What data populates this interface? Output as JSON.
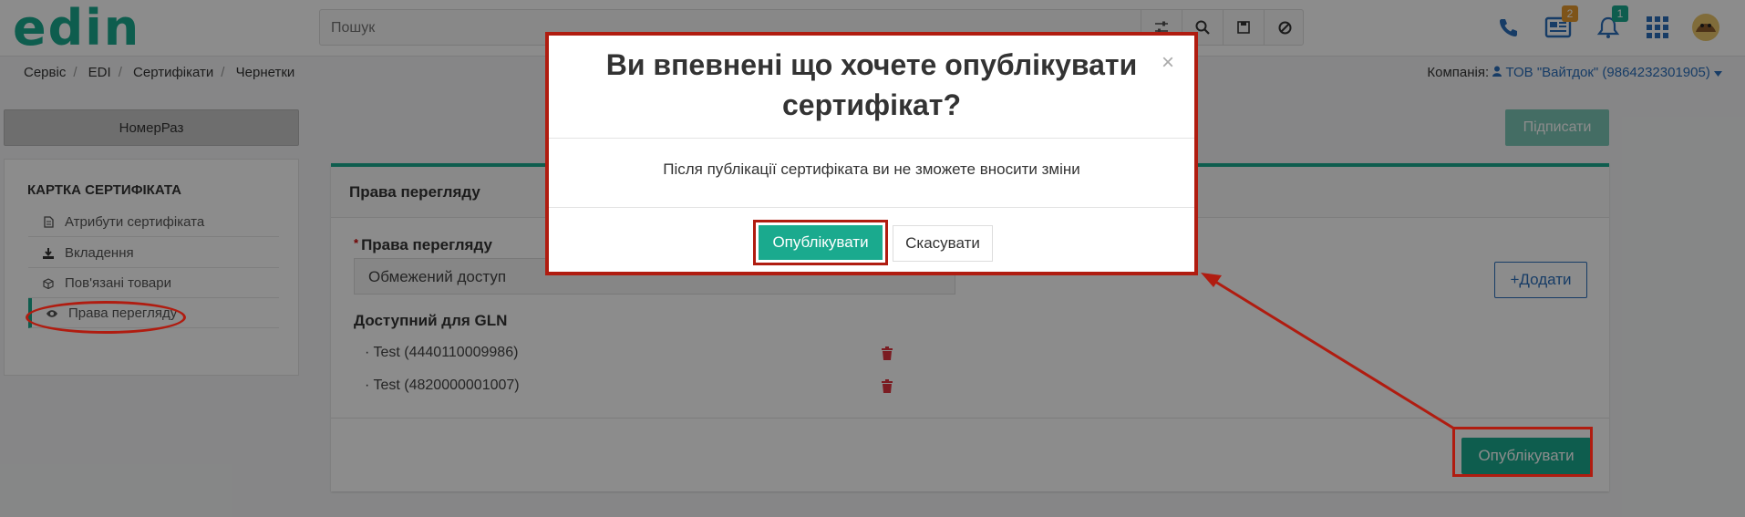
{
  "header": {
    "logo": "edin",
    "search_placeholder": "Пошук",
    "badges": {
      "news": "2",
      "notifications": "1"
    }
  },
  "breadcrumb": {
    "items": [
      "Сервіс",
      "EDI",
      "Сертифікати",
      "Чернетки"
    ]
  },
  "company": {
    "label": "Компанія:",
    "value": "ТОВ \"Вайтдок\" (9864232301905)"
  },
  "left": {
    "tab_label": "НомерРаз",
    "card_title": "КАРТКА СЕРТИФІКАТА",
    "items": [
      {
        "label": "Атрибути сертифіката",
        "icon": "document-icon"
      },
      {
        "label": "Вкладення",
        "icon": "download-icon"
      },
      {
        "label": "Пов'язані товари",
        "icon": "box-icon"
      },
      {
        "label": "Права перегляду",
        "icon": "eye-icon"
      }
    ]
  },
  "main": {
    "sign_button": "Підписати",
    "panel_title": "Права перегляду",
    "access_label": "Права перегляду",
    "access_value": "Обмежений доступ",
    "add_button": "+Додати",
    "gln_label": "Доступний для GLN",
    "gln_items": [
      "· Test (4440110009986)",
      "· Test (4820000001007)"
    ],
    "publish_button": "Опублікувати"
  },
  "modal": {
    "title_line1": "Ви впевнені що хочете опублікувати",
    "title_line2": "сертифікат?",
    "close": "×",
    "body": "Після публікації сертифіката ви не зможете вносити зміни",
    "confirm": "Опублікувати",
    "cancel": "Скасувати"
  },
  "colors": {
    "accent": "#1aaa8e",
    "annotation": "#b01c10",
    "link": "#2a6ebb"
  }
}
